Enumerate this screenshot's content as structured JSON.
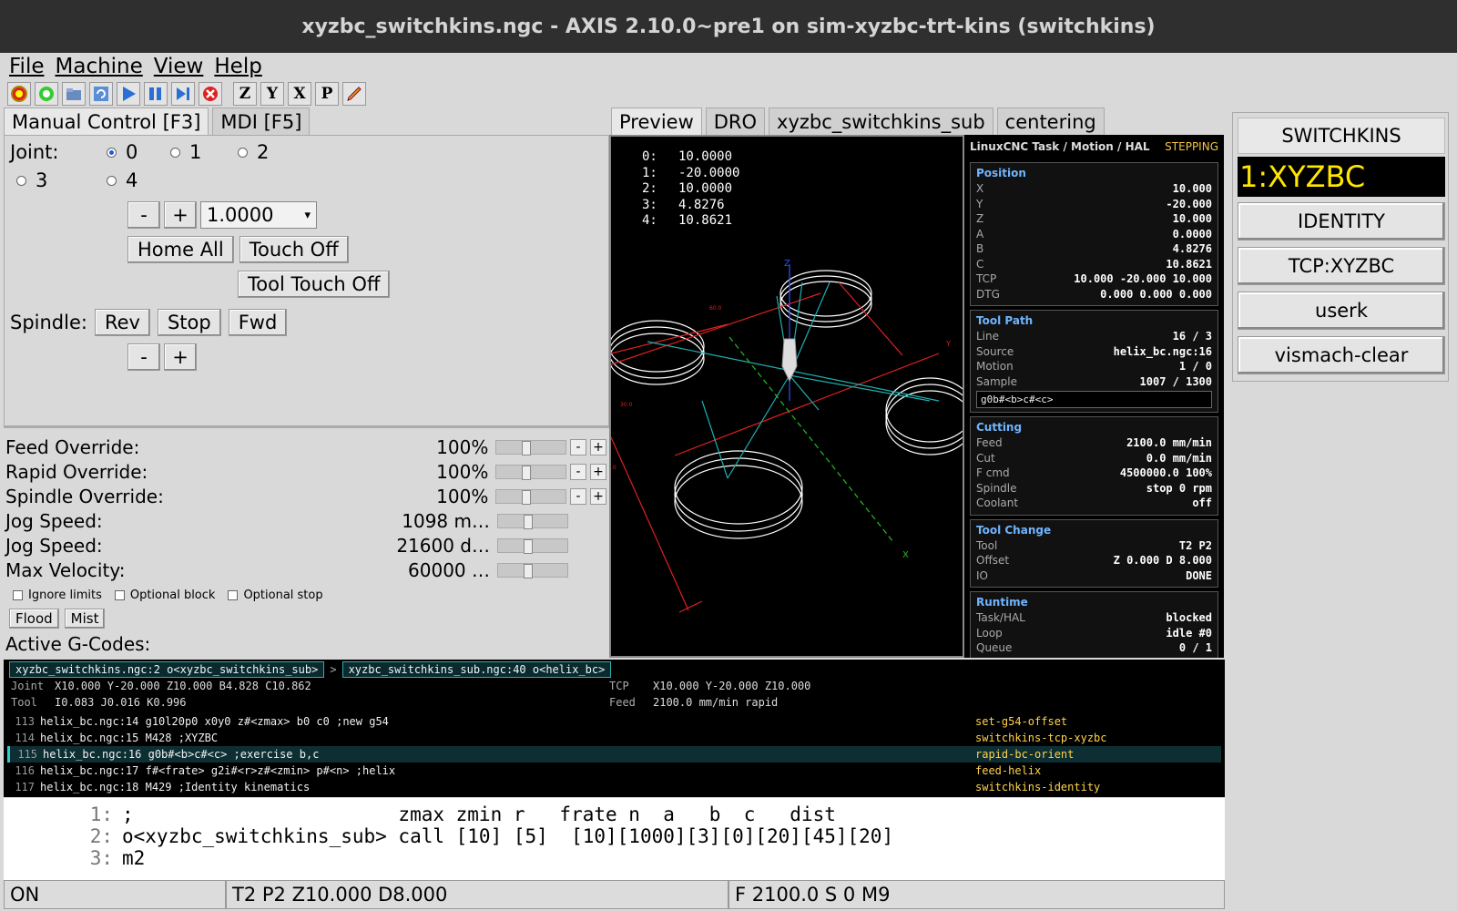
{
  "window": {
    "title": "xyzbc_switchkins.ngc - AXIS 2.10.0~pre1 on sim-xyzbc-trt-kins (switchkins)"
  },
  "menu": [
    "File",
    "Machine",
    "View",
    "Help"
  ],
  "toolbar": {
    "icons": [
      "estop-icon",
      "power-icon",
      "open-icon",
      "reload-icon",
      "run-icon",
      "step-icon",
      "pause-icon",
      "stop-icon"
    ],
    "view_buttons": [
      "Z",
      "Y",
      "X",
      "P"
    ]
  },
  "left_tabs": [
    "Manual Control [F3]",
    "MDI [F5]"
  ],
  "manual": {
    "joint_label": "Joint:",
    "joints": [
      "0",
      "1",
      "2",
      "3",
      "4"
    ],
    "selected_joint": "0",
    "minus": "-",
    "plus": "+",
    "increment": "1.0000",
    "home_all": "Home All",
    "touch_off": "Touch Off",
    "tool_touch_off": "Tool Touch Off",
    "spindle_label": "Spindle:",
    "rev": "Rev",
    "stop": "Stop",
    "fwd": "Fwd"
  },
  "overrides": [
    {
      "label": "Feed Override:",
      "value": "100%"
    },
    {
      "label": "Rapid Override:",
      "value": "100%"
    },
    {
      "label": "Spindle Override:",
      "value": "100%"
    },
    {
      "label": "Jog Speed:",
      "value": "1098 m…"
    },
    {
      "label": "Jog Speed:",
      "value": "21600 d…"
    },
    {
      "label": "Max Velocity:",
      "value": "60000 …"
    }
  ],
  "checks": [
    "Ignore limits",
    "Optional block",
    "Optional stop"
  ],
  "coolant": {
    "flood": "Flood",
    "mist": "Mist"
  },
  "active_gcodes_label": "Active G-Codes:",
  "preview_tabs": [
    "Preview",
    "DRO",
    "xyzbc_switchkins_sub",
    "centering"
  ],
  "preview_readout": [
    {
      "n": "0:",
      "v": "10.0000"
    },
    {
      "n": "1:",
      "v": "-20.0000"
    },
    {
      "n": "2:",
      "v": "10.0000"
    },
    {
      "n": "3:",
      "v": "4.8276"
    },
    {
      "n": "4:",
      "v": "10.8621"
    }
  ],
  "canvas_labels": {
    "x_axis": "X",
    "z_axis": "Z",
    "y_axis": "Y",
    "l1": "60.0",
    "l2": "30.0",
    "l3": "0"
  },
  "hud": {
    "title": "LinuxCNC Task / Motion / HAL",
    "state": "STEPPING",
    "position": {
      "heading": "Position",
      "rows": [
        [
          "X",
          "10.000"
        ],
        [
          "Y",
          "-20.000"
        ],
        [
          "Z",
          "10.000"
        ],
        [
          "A",
          "0.0000"
        ],
        [
          "B",
          "4.8276"
        ],
        [
          "C",
          "10.8621"
        ],
        [
          "TCP",
          "10.000 -20.000 10.000"
        ],
        [
          "DTG",
          "0.000 0.000 0.000"
        ]
      ]
    },
    "toolpath": {
      "heading": "Tool Path",
      "rows": [
        [
          "Line",
          "16 / 3"
        ],
        [
          "Source",
          "helix_bc.ngc:16"
        ],
        [
          "Motion",
          "1 / 0"
        ],
        [
          "Sample",
          "1007 / 1300"
        ]
      ],
      "code": "g0b#<b>c#<c>"
    },
    "cutting": {
      "heading": "Cutting",
      "rows": [
        [
          "Feed",
          "2100.0 mm/min"
        ],
        [
          "Cut",
          "0.0 mm/min"
        ],
        [
          "F cmd",
          "4500000.0 100%"
        ],
        [
          "Spindle",
          "stop 0 rpm"
        ],
        [
          "Coolant",
          "off"
        ]
      ]
    },
    "toolchange": {
      "heading": "Tool Change",
      "rows": [
        [
          "Tool",
          "T2 P2"
        ],
        [
          "Offset",
          "Z 0.000 D 8.000"
        ],
        [
          "IO",
          "DONE"
        ]
      ]
    },
    "runtime": {
      "heading": "Runtime",
      "rows": [
        [
          "Task/HAL",
          "blocked"
        ],
        [
          "Loop",
          "idle #0"
        ],
        [
          "Queue",
          "0 / 1"
        ]
      ]
    }
  },
  "right_panel": {
    "title": "SWITCHKINS",
    "display": "1:XYZBC",
    "buttons": [
      "IDENTITY",
      "TCP:XYZBC",
      "userk",
      "vismach-clear"
    ]
  },
  "status": {
    "crumb1": "xyzbc_switchkins.ngc:2 o<xyzbc_switchkins_sub>",
    "sep": ">",
    "crumb2": "xyzbc_switchkins_sub.ngc:40 o<helix_bc>",
    "joint_label": "Joint",
    "joint_val": "X10.000 Y-20.000 Z10.000 B4.828 C10.862",
    "tool_label": "Tool",
    "tool_val": "I0.083 J0.016 K0.996",
    "tcp_label": "TCP",
    "tcp_val": "X10.000 Y-20.000 Z10.000",
    "feed_label": "Feed",
    "feed_val": "2100.0 mm/min rapid",
    "lines": [
      {
        "n": "113",
        "t": "helix_bc.ngc:14 g10l20p0 x0y0 z#<zmax> b0 c0 ;new g54",
        "lab": "set-g54-offset"
      },
      {
        "n": "114",
        "t": "helix_bc.ngc:15 M428 ;XYZBC",
        "lab": "switchkins-tcp-xyzbc"
      },
      {
        "n": "115",
        "t": "helix_bc.ngc:16 g0b#<b>c#<c> ;exercise b,c",
        "lab": "rapid-bc-orient"
      },
      {
        "n": "116",
        "t": "helix_bc.ngc:17 f#<frate> g2i#<r>z#<zmin> p#<n> ;helix",
        "lab": "feed-helix"
      },
      {
        "n": "117",
        "t": "helix_bc.ngc:18 M429 ;Identity kinematics",
        "lab": "switchkins-identity"
      }
    ]
  },
  "editor": [
    {
      "n": "1:",
      "t": ";                       zmax zmin r   frate n  a   b  c   dist"
    },
    {
      "n": "2:",
      "t": "o<xyzbc_switchkins_sub> call [10] [5]  [10][1000][3][0][20][45][20]"
    },
    {
      "n": "3:",
      "t": "m2"
    }
  ],
  "statusbar": {
    "machine": "ON",
    "tool": "T2 P2 Z10.000 D8.000",
    "feed": "F 2100.0 S 0 M9"
  }
}
